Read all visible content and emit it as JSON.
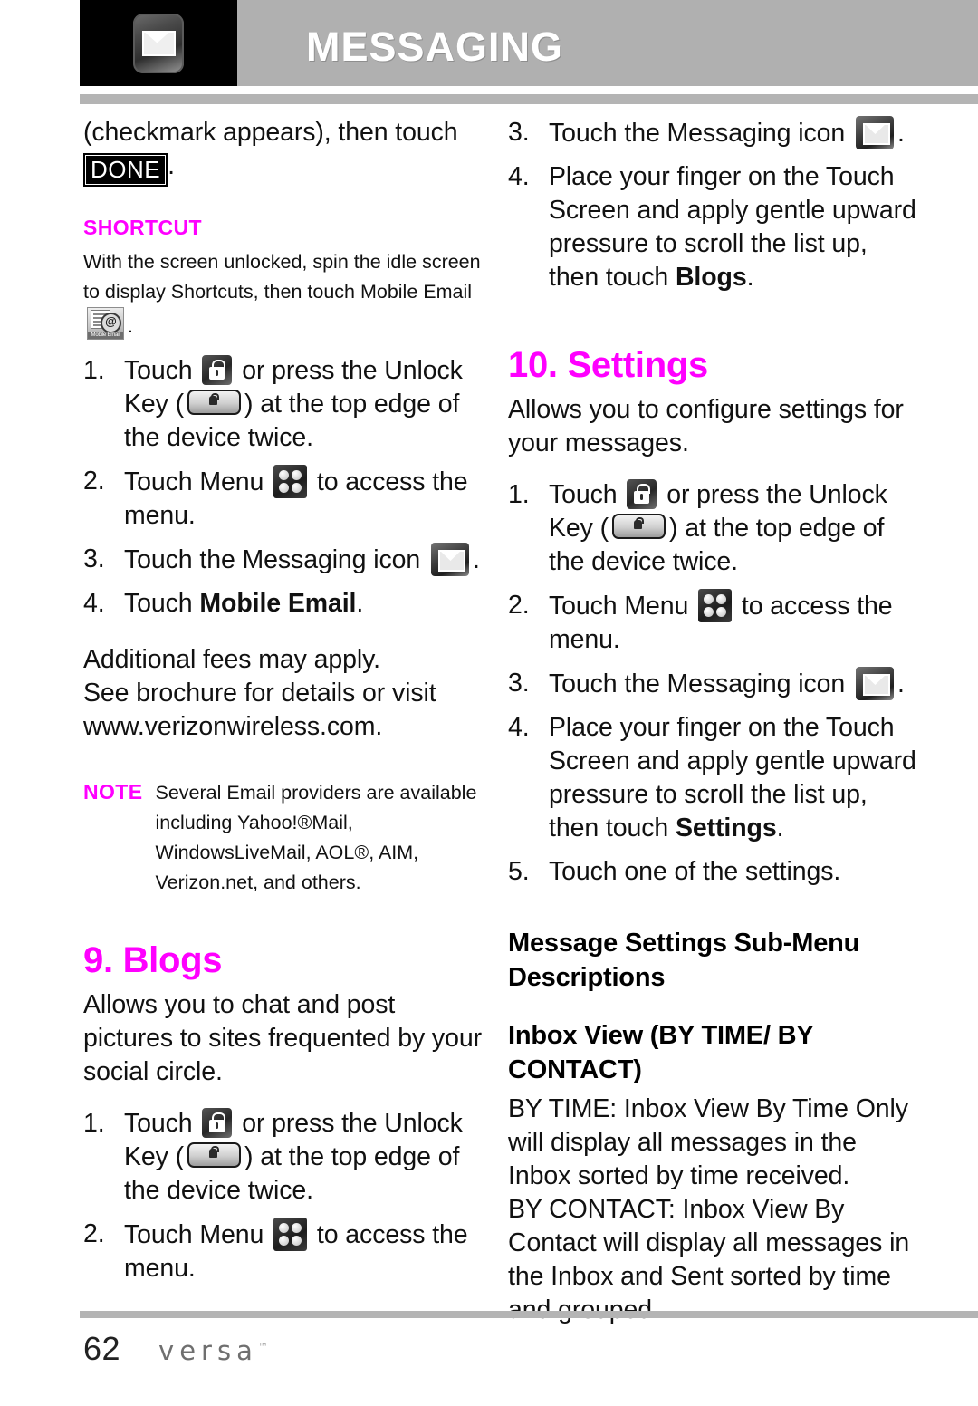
{
  "header": {
    "title": "MESSAGING",
    "icon": "messaging-envelope-icon"
  },
  "colors": {
    "accent_magenta": "#ff00ff",
    "header_band_gray": "#b0b0b0",
    "rule_gray": "#b4b4b4",
    "text_black": "#111111"
  },
  "left_column": {
    "continued_paragraph": {
      "before": "(checkmark appears), then touch",
      "badge": "DONE",
      "after": "."
    },
    "shortcut": {
      "label": "SHORTCUT",
      "text_before_icon": "With the screen unlocked, spin the idle screen to display Shortcuts, then touch Mobile Email",
      "icon": "mobile-email-icon",
      "icon_caption": "Mobile Email",
      "text_after_icon": "."
    },
    "steps": [
      {
        "num": "1.",
        "parts": [
          {
            "t": "text",
            "v": "Touch "
          },
          {
            "t": "icon",
            "v": "lock-icon"
          },
          {
            "t": "text",
            "v": " or press the Unlock Key ("
          },
          {
            "t": "icon",
            "v": "unlock-key-icon"
          },
          {
            "t": "text",
            "v": ") at the top edge of the device twice."
          }
        ]
      },
      {
        "num": "2.",
        "parts": [
          {
            "t": "text",
            "v": "Touch Menu "
          },
          {
            "t": "icon",
            "v": "menu-grid-icon"
          },
          {
            "t": "text",
            "v": " to access the menu."
          }
        ]
      },
      {
        "num": "3.",
        "parts": [
          {
            "t": "text",
            "v": "Touch the Messaging icon "
          },
          {
            "t": "icon",
            "v": "messaging-icon"
          },
          {
            "t": "text",
            "v": "."
          }
        ]
      },
      {
        "num": "4.",
        "parts": [
          {
            "t": "text",
            "v": "Touch "
          },
          {
            "t": "bold",
            "v": "Mobile Email"
          },
          {
            "t": "text",
            "v": "."
          }
        ]
      }
    ],
    "fees_note": [
      "Additional fees may apply.",
      "See brochure for details or visit",
      "www.verizonwireless.com."
    ],
    "note": {
      "label": "NOTE",
      "lines": [
        "Several Email providers are available",
        "including Yahoo!®Mail,",
        "WindowsLiveMail, AOL®, AIM,",
        "Verizon.net, and others."
      ]
    },
    "blogs_section": {
      "heading": "9. Blogs",
      "intro": "Allows you to chat and post pictures to sites frequented by your social circle.",
      "steps": [
        {
          "num": "1.",
          "parts": [
            {
              "t": "text",
              "v": "Touch "
            },
            {
              "t": "icon",
              "v": "lock-icon"
            },
            {
              "t": "text",
              "v": " or press the Unlock Key ("
            },
            {
              "t": "icon",
              "v": "unlock-key-icon"
            },
            {
              "t": "text",
              "v": ") at the top edge of the device twice."
            }
          ]
        },
        {
          "num": "2.",
          "parts": [
            {
              "t": "text",
              "v": "Touch Menu "
            },
            {
              "t": "icon",
              "v": "menu-grid-icon"
            },
            {
              "t": "text",
              "v": " to access the menu."
            }
          ]
        }
      ]
    }
  },
  "right_column": {
    "blogs_steps_continued": [
      {
        "num": "3.",
        "parts": [
          {
            "t": "text",
            "v": "Touch the Messaging icon "
          },
          {
            "t": "icon",
            "v": "messaging-icon"
          },
          {
            "t": "text",
            "v": "."
          }
        ]
      },
      {
        "num": "4.",
        "parts": [
          {
            "t": "text",
            "v": "Place your finger on the Touch Screen and apply gentle upward pressure to scroll the list up, then touch "
          },
          {
            "t": "bold",
            "v": "Blogs"
          },
          {
            "t": "text",
            "v": "."
          }
        ]
      }
    ],
    "settings_section": {
      "heading": "10. Settings",
      "intro": "Allows you to configure settings for your messages.",
      "steps": [
        {
          "num": "1.",
          "parts": [
            {
              "t": "text",
              "v": "Touch "
            },
            {
              "t": "icon",
              "v": "lock-icon"
            },
            {
              "t": "text",
              "v": " or press the Unlock Key ("
            },
            {
              "t": "icon",
              "v": "unlock-key-icon"
            },
            {
              "t": "text",
              "v": ") at the top edge of the device twice."
            }
          ]
        },
        {
          "num": "2.",
          "parts": [
            {
              "t": "text",
              "v": "Touch Menu "
            },
            {
              "t": "icon",
              "v": "menu-grid-icon"
            },
            {
              "t": "text",
              "v": " to access the menu."
            }
          ]
        },
        {
          "num": "3.",
          "parts": [
            {
              "t": "text",
              "v": "Touch the Messaging icon "
            },
            {
              "t": "icon",
              "v": "messaging-icon"
            },
            {
              "t": "text",
              "v": "."
            }
          ]
        },
        {
          "num": "4.",
          "parts": [
            {
              "t": "text",
              "v": "Place your finger on the Touch Screen and apply gentle upward pressure to scroll the list up, then touch "
            },
            {
              "t": "bold",
              "v": "Settings"
            },
            {
              "t": "text",
              "v": "."
            }
          ]
        },
        {
          "num": "5.",
          "parts": [
            {
              "t": "text",
              "v": "Touch one of the settings."
            }
          ]
        }
      ]
    },
    "submenu_heading": "Message Settings Sub-Menu Descriptions",
    "inbox_view_heading": "Inbox View (BY TIME/ BY CONTACT)",
    "inbox_view_body": [
      "BY TIME: Inbox View By Time Only will display all messages in the Inbox sorted by time received.",
      "BY CONTACT: Inbox View By Contact will display all messages in the Inbox and Sent sorted by time and grouped"
    ]
  },
  "footer": {
    "page_number": "62",
    "brand": "versa",
    "brand_tm": "™"
  }
}
